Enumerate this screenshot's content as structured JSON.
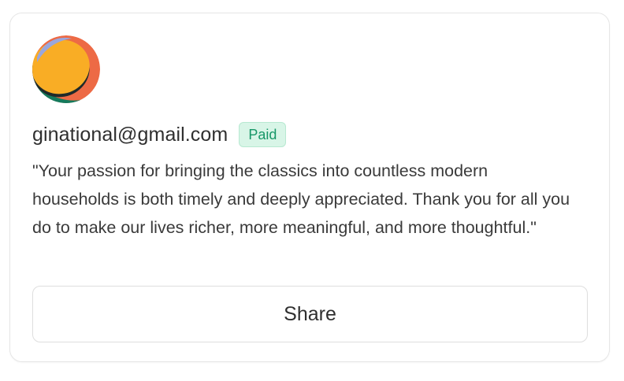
{
  "card": {
    "avatar_icon": "user-avatar",
    "email": "ginational@gmail.com",
    "badge": "Paid",
    "quote": "\"Your passion for bringing the classics into countless modern households is both timely and deeply appreciated. Thank you for all you do to make our lives richer, more meaningful, and more thoughtful.\"",
    "share_label": "Share"
  },
  "colors": {
    "badge_bg": "#d8f5e7",
    "badge_text": "#179768",
    "avatar_yellow": "#f9ad25",
    "avatar_green": "#147a5c",
    "avatar_orange": "#ed6a45",
    "avatar_lavender": "#9aa6dc"
  }
}
